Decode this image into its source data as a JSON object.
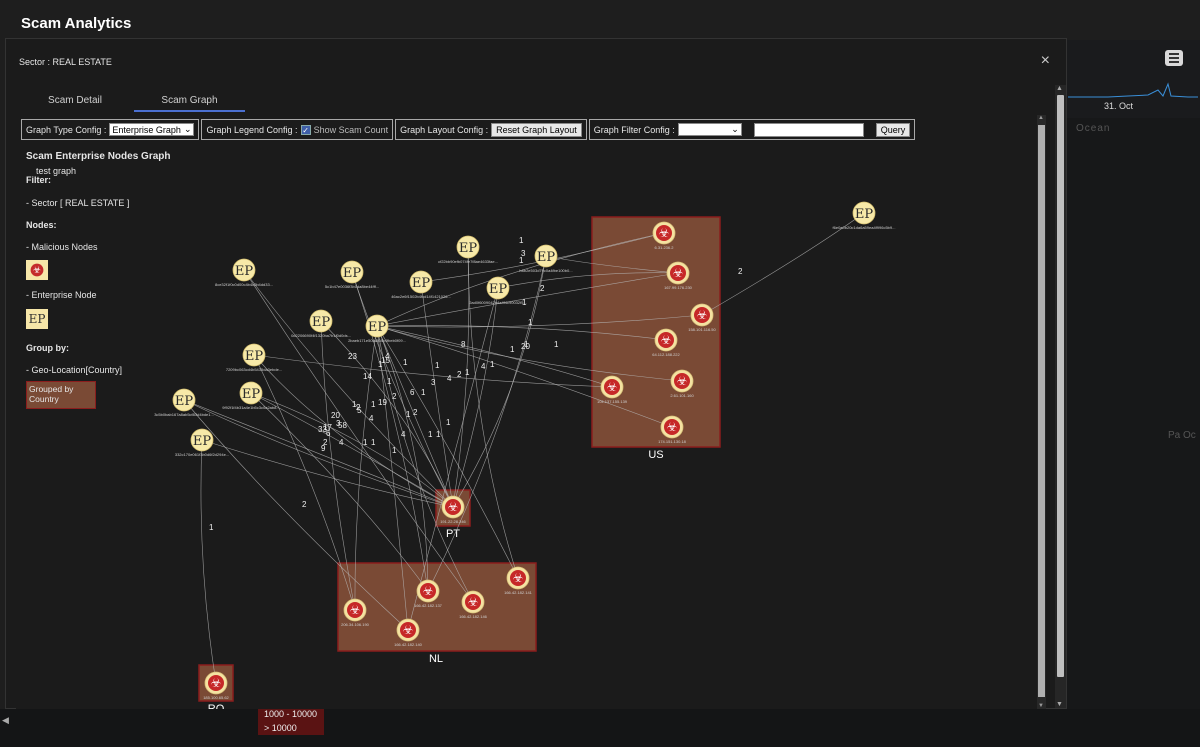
{
  "app": {
    "title": "Scam Analytics"
  },
  "background": {
    "date_label": "31. Oct",
    "ocean_label": "Ocean",
    "pacific_label": "Pa\nOc",
    "legend_items": [
      "1000 - 10000",
      "> 10000"
    ]
  },
  "modal": {
    "title": "Sector : REAL ESTATE",
    "close_symbol": "×",
    "tabs": [
      {
        "label": "Scam Detail",
        "active": false
      },
      {
        "label": "Scam Graph",
        "active": true
      }
    ]
  },
  "toolbar": {
    "graph_type": {
      "label": "Graph Type Config :",
      "selected": "Enterprise Graph"
    },
    "graph_legend": {
      "label": "Graph Legend Config :",
      "checkbox_label": "Show Scam Count",
      "checked": true
    },
    "graph_layout": {
      "label": "Graph Layout Config :",
      "button": "Reset Graph Layout"
    },
    "graph_filter": {
      "label": "Graph Filter Config :",
      "selected": "",
      "input_value": "",
      "button": "Query"
    }
  },
  "legend": {
    "title": "Scam Enterprise Nodes Graph",
    "subtitle": "test graph",
    "filter_heading": "Filter:",
    "filter_value": "- Sector [ REAL ESTATE ]",
    "nodes_heading": "Nodes:",
    "malicious_label": "- Malicious Nodes",
    "enterprise_label": "- Enterprise Node",
    "group_heading": "Group by:",
    "group_value": "- Geo-Location[Country]",
    "group_box": "Grouped by Country"
  },
  "graph": {
    "groups": [
      {
        "name": "US"
      },
      {
        "name": "PT"
      },
      {
        "name": "NL"
      },
      {
        "name": "RO"
      }
    ],
    "malicious_nodes": [
      {
        "id": "m1",
        "label": "6.31.236.2",
        "group": "US"
      },
      {
        "id": "m2",
        "label": "167.99.176.230",
        "group": "US"
      },
      {
        "id": "m3",
        "label": "158.101.116.50",
        "group": "US"
      },
      {
        "id": "m4",
        "label": "64.112.188.222",
        "group": "US"
      },
      {
        "id": "m5",
        "label": "104.137.155.139",
        "group": "US"
      },
      {
        "id": "m6",
        "label": "2.61.101.160",
        "group": "US"
      },
      {
        "id": "m7",
        "label": "174.151.130.18",
        "group": "US"
      },
      {
        "id": "m8",
        "label": "191.22.28.246",
        "group": "PT"
      },
      {
        "id": "m9",
        "label": "166.42.182.141",
        "group": "NL"
      },
      {
        "id": "m10",
        "label": "166.42.182.137",
        "group": "NL"
      },
      {
        "id": "m11",
        "label": "166.42.182.146",
        "group": "NL"
      },
      {
        "id": "m12",
        "label": "206.34.106.190",
        "group": "NL"
      },
      {
        "id": "m13",
        "label": "166.42.182.140",
        "group": "NL"
      },
      {
        "id": "m14",
        "label": "185.100.65.62",
        "group": "RO"
      }
    ],
    "enterprise_nodes": [
      {
        "id": "e1",
        "label": "f6e0a0b20c1da6a59ea4f996c5b9..."
      },
      {
        "id": "e2",
        "label": "cf22bb90efb074fe7f8ae4633fae..."
      },
      {
        "id": "e3",
        "label": "b8b2e503d79c0a4fbe100b0..."
      },
      {
        "id": "e4",
        "label": "8ce32f1f0c0d00c4b4c0b4dd33..."
      },
      {
        "id": "e5",
        "label": "5c1b47e0036f3b1da8be44fff..."
      },
      {
        "id": "e6",
        "label": "46ac2e6f1502b4fcd14f1421026..."
      },
      {
        "id": "e7",
        "label": "2ad0f6009042b4a4f4c90032f5..."
      },
      {
        "id": "e8",
        "label": "0d2206690f4f1320ba7b1f0d0ds..."
      },
      {
        "id": "e9",
        "label": "2baeb171e50fa808b4fbeb0f09..."
      },
      {
        "id": "e10",
        "label": "7209bc063cd4b5435da3ebde..."
      },
      {
        "id": "e11",
        "label": "9f92f1f4b31a4e1b5c3c0a2ab8..."
      },
      {
        "id": "e12",
        "label": "3c5b0bab167a8ab5cf83d4bde1..."
      },
      {
        "id": "e13",
        "label": "332c170e061f3b0d6f2d294e..."
      }
    ],
    "edge_labels": [
      "1",
      "3",
      "1",
      "2",
      "1",
      "1",
      "1",
      "1",
      "2",
      "2",
      "1",
      "23",
      "15",
      "4",
      "1",
      "8",
      "1",
      "1",
      "20",
      "1",
      "14",
      "1",
      "3",
      "4",
      "2",
      "1",
      "4",
      "1",
      "19",
      "1",
      "2",
      "6",
      "1",
      "1",
      "5",
      "4",
      "20",
      "3",
      "58",
      "17",
      "33",
      "6",
      "2",
      "9",
      "4",
      "1",
      "1",
      "1",
      "4",
      "1",
      "1",
      "1",
      "1",
      "2",
      "2"
    ]
  }
}
